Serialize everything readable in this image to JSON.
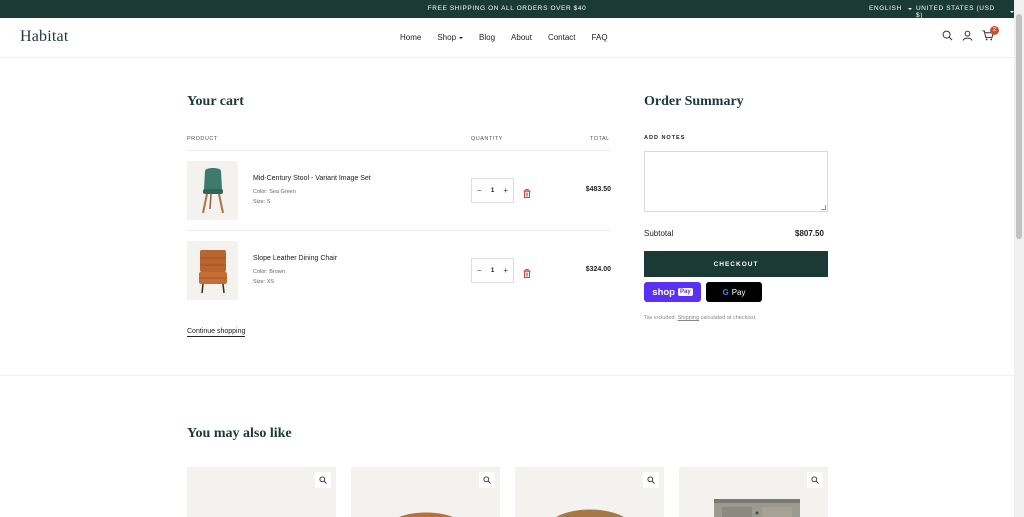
{
  "announcement": {
    "message": "FREE SHIPPING ON ALL ORDERS OVER $40",
    "language": "ENGLISH",
    "country": "UNITED STATES (USD $)"
  },
  "header": {
    "logo": "Habitat",
    "nav": [
      "Home",
      "Shop",
      "Blog",
      "About",
      "Contact",
      "FAQ"
    ],
    "cart_count": "2"
  },
  "cart": {
    "title": "Your cart",
    "columns": {
      "product": "PRODUCT",
      "quantity": "QUANTITY",
      "total": "TOTAL"
    },
    "items": [
      {
        "name": "Mid-Century Stool - Variant Image Set",
        "color": "Color: Sea Green",
        "size": "Size: S",
        "quantity": "1",
        "total": "$483.50"
      },
      {
        "name": "Slope Leather Dining Chair",
        "color": "Color: Brown",
        "size": "Size: XS",
        "quantity": "1",
        "total": "$324.00"
      }
    ],
    "continue_label": "Continue shopping"
  },
  "summary": {
    "title": "Order Summary",
    "notes_label": "ADD NOTES",
    "notes_value": "",
    "subtotal_label": "Subtotal",
    "subtotal_value": "$807.50",
    "checkout_label": "CHECKOUT",
    "shop_pay": {
      "brand": "shop",
      "pay": "Pay"
    },
    "gpay": {
      "g": "G",
      "pay": "Pay"
    },
    "tax_before": "Tax included. ",
    "tax_link": "Shipping",
    "tax_after": " calculated at checkout."
  },
  "recommendations": {
    "title": "You may also like"
  },
  "colors": {
    "brand_dark": "#1b3a36",
    "badge": "#c2572c",
    "shop_pay": "#5a31f4",
    "delete": "#c0392b"
  },
  "icons": [
    "search-icon",
    "account-icon",
    "cart-icon",
    "trash-icon",
    "zoom-icon",
    "chevron-down-icon"
  ]
}
